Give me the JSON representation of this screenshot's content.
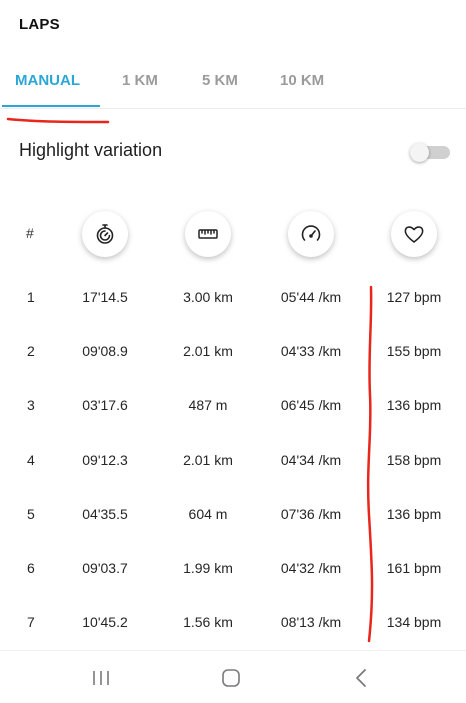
{
  "header": {
    "title": "LAPS"
  },
  "tabs": [
    {
      "label": "MANUAL",
      "active": true
    },
    {
      "label": "1 KM",
      "active": false
    },
    {
      "label": "5 KM",
      "active": false
    },
    {
      "label": "10 KM",
      "active": false
    }
  ],
  "highlight": {
    "label": "Highlight variation",
    "enabled": false
  },
  "table": {
    "number_header": "#",
    "column_icons": [
      "stopwatch-icon",
      "ruler-icon",
      "speedometer-icon",
      "heart-icon"
    ],
    "rows": [
      {
        "num": "1",
        "time": "17'14.5",
        "distance": "3.00 km",
        "pace": "05'44 /km",
        "hr": "127 bpm"
      },
      {
        "num": "2",
        "time": "09'08.9",
        "distance": "2.01 km",
        "pace": "04'33 /km",
        "hr": "155 bpm"
      },
      {
        "num": "3",
        "time": "03'17.6",
        "distance": "487 m",
        "pace": "06'45 /km",
        "hr": "136 bpm"
      },
      {
        "num": "4",
        "time": "09'12.3",
        "distance": "2.01 km",
        "pace": "04'34 /km",
        "hr": "158 bpm"
      },
      {
        "num": "5",
        "time": "04'35.5",
        "distance": "604 m",
        "pace": "07'36 /km",
        "hr": "136 bpm"
      },
      {
        "num": "6",
        "time": "09'03.7",
        "distance": "1.99 km",
        "pace": "04'32 /km",
        "hr": "161 bpm"
      },
      {
        "num": "7",
        "time": "10'45.2",
        "distance": "1.56 km",
        "pace": "08'13 /km",
        "hr": "134 bpm"
      }
    ]
  },
  "colors": {
    "accent": "#2aa7d6",
    "annotation": "#e8261c",
    "tab_inactive": "#9b9b9b"
  },
  "navbar": {
    "icons": [
      "recent-apps-icon",
      "home-icon",
      "back-icon"
    ]
  }
}
